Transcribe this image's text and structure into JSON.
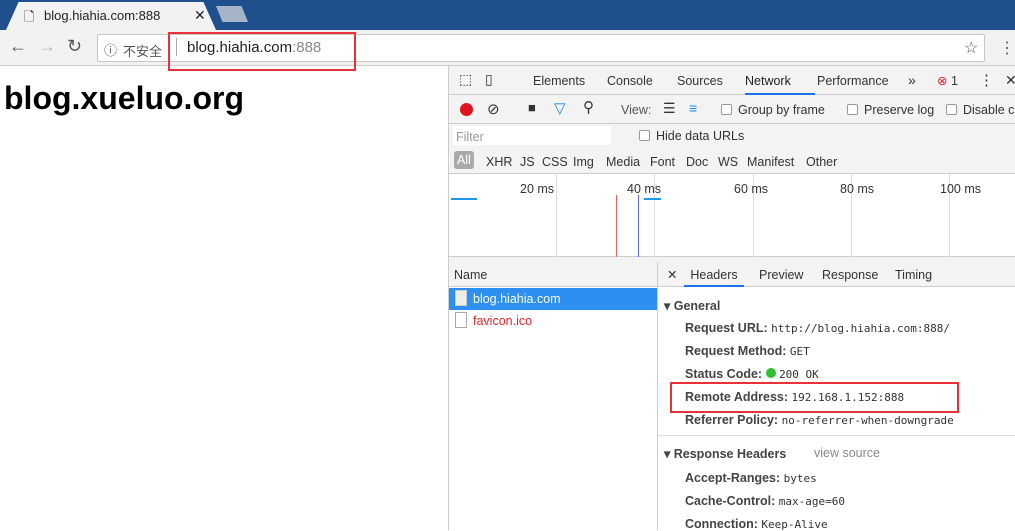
{
  "browser": {
    "tab_title": "blog.hiahia.com:888",
    "security_label": "不安全",
    "url_host": "blog.hiahia.com",
    "url_port": ":888"
  },
  "page": {
    "heading": "blog.xueluo.org"
  },
  "devtools": {
    "tabs": [
      "Elements",
      "Console",
      "Sources",
      "Network",
      "Performance"
    ],
    "active_tab": "Network",
    "more": "»",
    "error_count": "1",
    "view_label": "View:",
    "group_by_frame": "Group by frame",
    "preserve_log": "Preserve log",
    "disable_cache": "Disable c",
    "filter_placeholder": "Filter",
    "hide_data_urls": "Hide data URLs",
    "types": [
      "All",
      "XHR",
      "JS",
      "CSS",
      "Img",
      "Media",
      "Font",
      "Doc",
      "WS",
      "Manifest",
      "Other"
    ],
    "timeline_ticks": [
      "20 ms",
      "40 ms",
      "60 ms",
      "80 ms",
      "100 ms"
    ],
    "name_header": "Name",
    "requests": [
      {
        "name": "blog.hiahia.com",
        "selected": true
      },
      {
        "name": "favicon.ico",
        "error": true
      }
    ],
    "detail_tabs": [
      "Headers",
      "Preview",
      "Response",
      "Timing"
    ],
    "general": {
      "title": "General",
      "rows": [
        {
          "label": "Request URL:",
          "value": "http://blog.hiahia.com:888/"
        },
        {
          "label": "Request Method:",
          "value": "GET"
        },
        {
          "label": "Status Code:",
          "value": "200 OK"
        },
        {
          "label": "Remote Address:",
          "value": "192.168.1.152:888"
        },
        {
          "label": "Referrer Policy:",
          "value": "no-referrer-when-downgrade"
        }
      ]
    },
    "response_headers": {
      "title": "Response Headers",
      "view_source": "view source",
      "rows": [
        {
          "label": "Accept-Ranges:",
          "value": "bytes"
        },
        {
          "label": "Cache-Control:",
          "value": "max-age=60"
        },
        {
          "label": "Connection:",
          "value": "Keep-Alive"
        }
      ]
    }
  },
  "colors": {
    "accent": "#1a73e8",
    "highlight": "#e8323a",
    "selected_row": "#2d8ff0",
    "error_text": "#e0272e"
  }
}
